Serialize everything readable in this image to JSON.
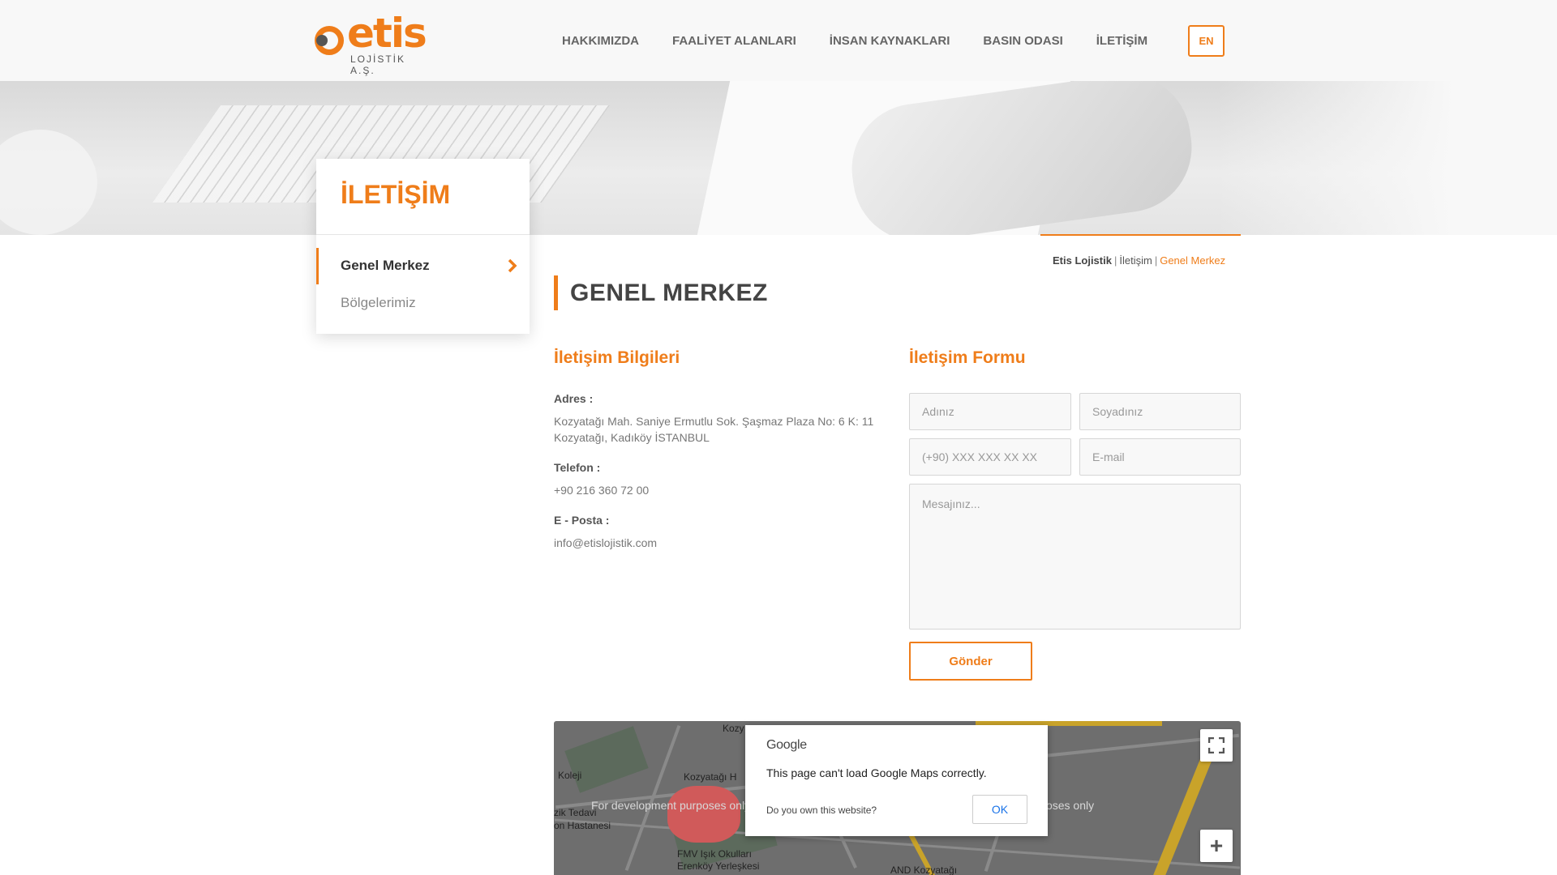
{
  "header": {
    "logo_text": "etis",
    "logo_sub": "LOJİSTİK A.Ş.",
    "nav": [
      {
        "label": "HAKKIMIZDA"
      },
      {
        "label": "FAALİYET ALANLARI"
      },
      {
        "label": "İNSAN KAYNAKLARI"
      },
      {
        "label": "BASIN ODASI"
      },
      {
        "label": "İLETİŞİM"
      }
    ],
    "lang_button": "EN"
  },
  "sidebar": {
    "title": "İLETİŞİM",
    "items": [
      {
        "label": "Genel Merkez",
        "active": true
      },
      {
        "label": "Bölgelerimiz",
        "active": false
      }
    ]
  },
  "breadcrumb": {
    "items": [
      "Etis Lojistik",
      "İletişim",
      "Genel Merkez"
    ],
    "separator": "|"
  },
  "page_title": "GENEL MERKEZ",
  "contact_info": {
    "heading": "İletişim Bilgileri",
    "address_label": "Adres :",
    "address_line1": "Kozyatağı Mah. Saniye Ermutlu Sok. Şaşmaz Plaza No: 6 K: 11",
    "address_line2": "Kozyatağı, Kadıköy İSTANBUL",
    "phone_label": "Telefon :",
    "phone_value": "+90 216 360 72 00",
    "email_label": "E - Posta :",
    "email_value": "info@etislojistik.com"
  },
  "contact_form": {
    "heading": "İletişim Formu",
    "first_name_placeholder": "Adınız",
    "last_name_placeholder": "Soyadınız",
    "phone_placeholder": "(+90) XXX XXX XX XX",
    "email_placeholder": "E-mail",
    "message_placeholder": "Mesajınız...",
    "submit_label": "Gönder"
  },
  "map": {
    "dev_text": "For development purposes only",
    "labels": [
      "Koleji",
      "Kozyatağı H",
      "zik Tedavi",
      "on Hastanesi",
      "FMV Işık Okulları",
      "Erenköy Yerleşkesi",
      "AND Kozyatağı",
      "Kozy"
    ],
    "dialog_brand": "Google",
    "dialog_message": "This page can't load Google Maps correctly.",
    "dialog_own_link": "Do you own this website?",
    "dialog_ok": "OK",
    "zoom_in": "+"
  },
  "colors": {
    "accent": "#ef7d1a",
    "text_dark": "#444444",
    "text_muted": "#777777"
  }
}
